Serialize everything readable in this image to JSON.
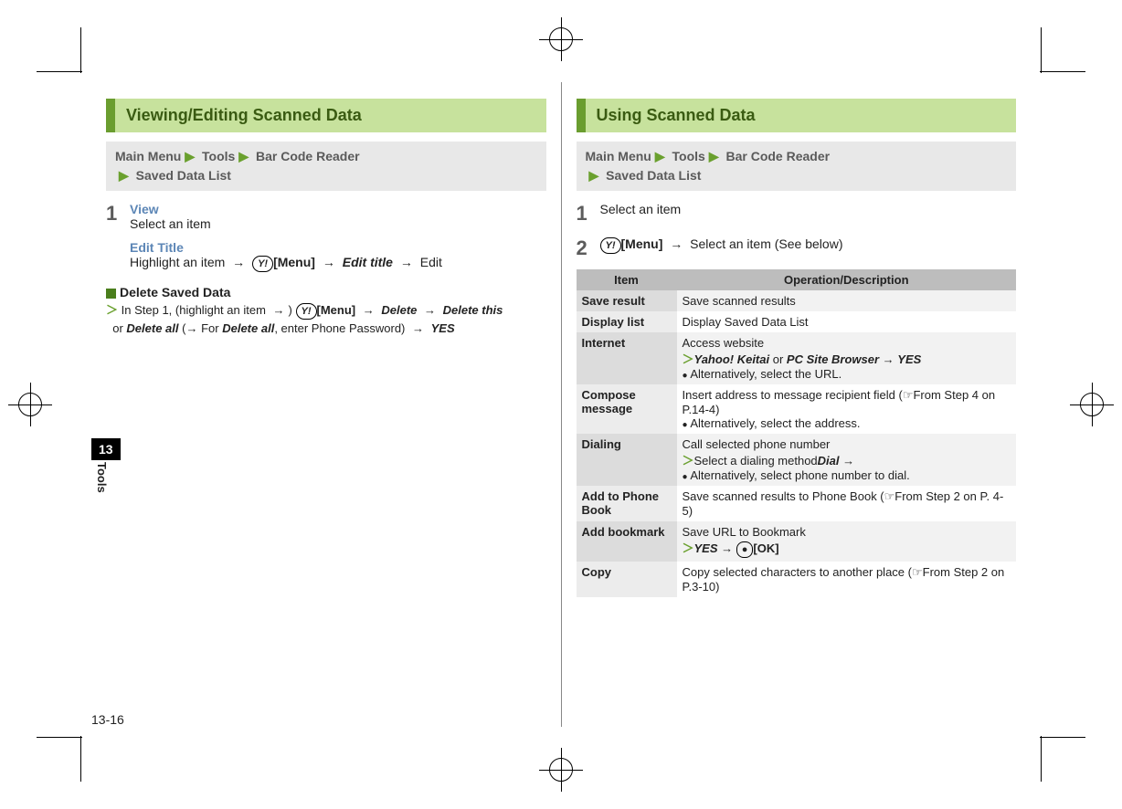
{
  "crop_marks": true,
  "side_tab": {
    "chapter": "13",
    "label": "Tools"
  },
  "page_number": "13-16",
  "left": {
    "title": "Viewing/Editing Scanned Data",
    "breadcrumb": [
      "Main Menu",
      "Tools",
      "Bar Code Reader",
      "Saved Data List"
    ],
    "step1": {
      "num": "1",
      "view_label": "View",
      "view_text": "Select an item",
      "edit_label": "Edit Title",
      "edit_prefix": "Highlight an item",
      "arrow": "→",
      "key": "Y!",
      "menu": "[Menu]",
      "edit_title": "Edit title",
      "edit_suffix": "Edit"
    },
    "delete": {
      "heading": "Delete Saved Data",
      "line1a": "In Step 1, (highlight an item",
      "arrow": "→",
      "close": ")",
      "key": "Y!",
      "menu": "[Menu]",
      "delete": "Delete",
      "delete_this": "Delete this",
      "or": "or",
      "delete_all": "Delete all",
      "paren": "(→ For",
      "delete_all2": "Delete all",
      "paren_end": ", enter Phone Password)",
      "yes": "YES"
    }
  },
  "right": {
    "title": "Using Scanned Data",
    "breadcrumb": [
      "Main Menu",
      "Tools",
      "Bar Code Reader",
      "Saved Data List"
    ],
    "step1": {
      "num": "1",
      "text": "Select an item"
    },
    "step2": {
      "num": "2",
      "key": "Y!",
      "menu": "[Menu]",
      "arrow": "→",
      "text": "Select an item (See below)"
    },
    "table": {
      "head": [
        "Item",
        "Operation/Description"
      ],
      "rows": [
        {
          "item": "Save result",
          "desc": {
            "lines": [
              "Save scanned results"
            ]
          }
        },
        {
          "item": "Display list",
          "desc": {
            "lines": [
              "Display Saved Data List"
            ]
          }
        },
        {
          "item": "Internet",
          "desc": {
            "lines": [
              "Access website"
            ],
            "action": {
              "ang": ">",
              "bold1": "Yahoo! Keitai",
              "or": " or ",
              "bold2": "PC Site Browser",
              "arrow": " → ",
              "yes": "YES"
            },
            "bullet": "Alternatively, select the URL."
          }
        },
        {
          "item": "Compose message",
          "desc": {
            "lines": [
              "Insert address to message recipient field (☞From Step 4 on P.14-4)"
            ],
            "bullet": "Alternatively, select the address."
          }
        },
        {
          "item": "Dialing",
          "desc": {
            "lines": [
              "Call selected phone number"
            ],
            "action": {
              "ang": ">",
              "plain": "Select a dialing method",
              "arrow": " → ",
              "bold1": "Dial"
            },
            "bullet": "Alternatively, select phone number to dial."
          }
        },
        {
          "item": "Add to Phone Book",
          "desc": {
            "lines": [
              "Save scanned results to Phone Book (☞From Step 2 on P. 4-5)"
            ]
          }
        },
        {
          "item": "Add bookmark",
          "desc": {
            "lines": [
              "Save URL to Bookmark"
            ],
            "action": {
              "ang": ">",
              "bold1": "YES",
              "arrow": " → ",
              "keycap": "●",
              "ok": "[OK]"
            }
          }
        },
        {
          "item": "Copy",
          "desc": {
            "lines": [
              "Copy selected characters to another place (☞From Step 2 on P.3-10)"
            ]
          }
        }
      ]
    }
  }
}
